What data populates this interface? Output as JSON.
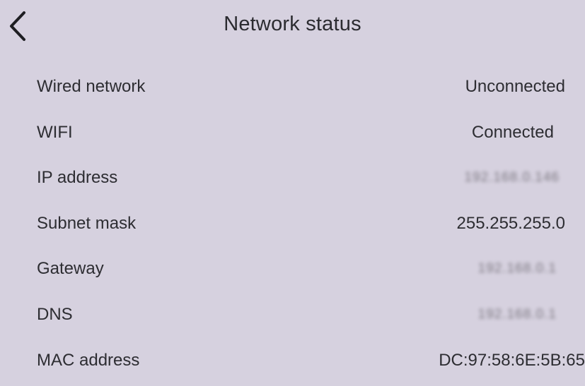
{
  "header": {
    "title": "Network status",
    "back_icon": "chevron-left-icon"
  },
  "rows": [
    {
      "label": "Wired network",
      "value": "Unconnected",
      "blurred": false
    },
    {
      "label": "WIFI",
      "value": "Connected",
      "blurred": false
    },
    {
      "label": "IP address",
      "value": "192.168.0.146",
      "blurred": true
    },
    {
      "label": "Subnet mask",
      "value": "255.255.255.0",
      "blurred": false
    },
    {
      "label": "Gateway",
      "value": "192.168.0.1",
      "blurred": true
    },
    {
      "label": "DNS",
      "value": "192.168.0.1",
      "blurred": true
    },
    {
      "label": "MAC address",
      "value": "DC:97:58:6E:5B:65",
      "blurred": false
    }
  ],
  "colors": {
    "background": "#d6d1df",
    "text": "#2d2d32"
  }
}
